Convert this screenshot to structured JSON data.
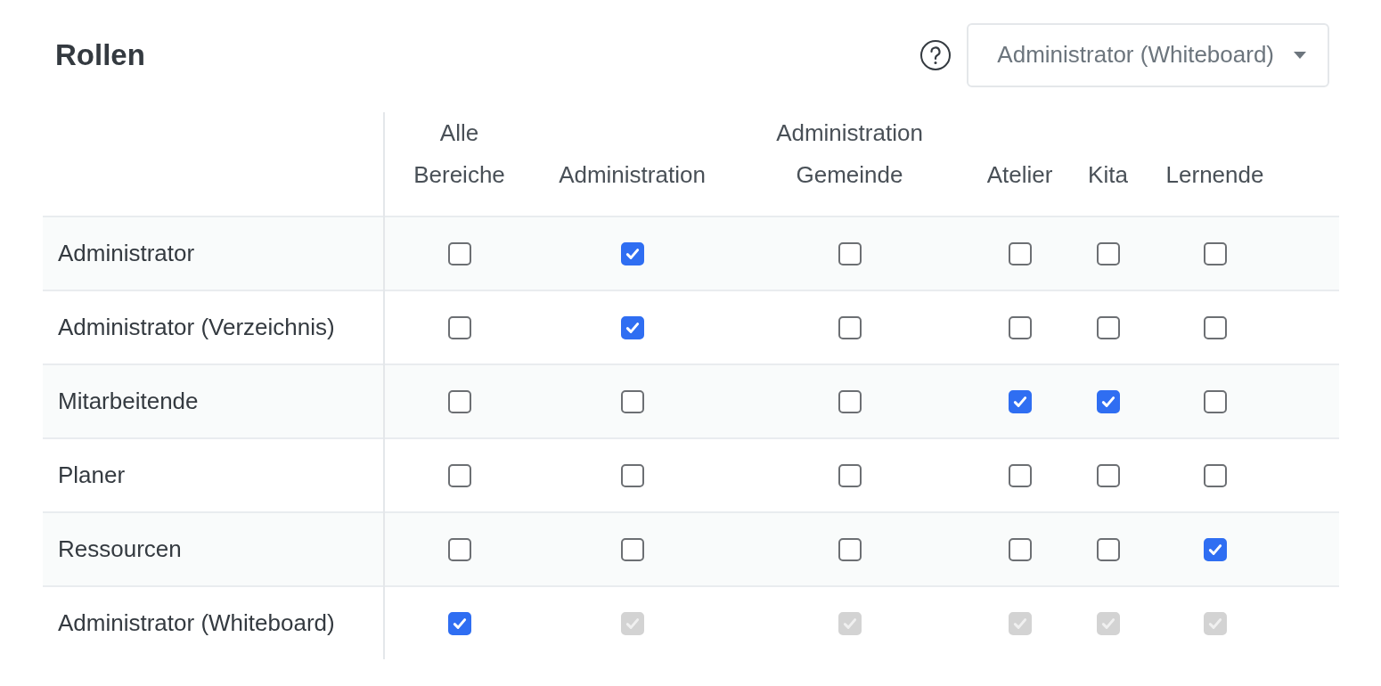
{
  "title": "Rollen",
  "role_select": {
    "value": "Administrator (Whiteboard)"
  },
  "table": {
    "columns": [
      "Alle Bereiche",
      "Administration",
      "Administration Gemeinde",
      "Atelier",
      "Kita",
      "Lernende"
    ],
    "rows": [
      {
        "label": "Administrator",
        "cells": [
          {
            "checked": false,
            "disabled": false
          },
          {
            "checked": true,
            "disabled": false
          },
          {
            "checked": false,
            "disabled": false
          },
          {
            "checked": false,
            "disabled": false
          },
          {
            "checked": false,
            "disabled": false
          },
          {
            "checked": false,
            "disabled": false
          }
        ]
      },
      {
        "label": "Administrator (Verzeichnis)",
        "cells": [
          {
            "checked": false,
            "disabled": false
          },
          {
            "checked": true,
            "disabled": false
          },
          {
            "checked": false,
            "disabled": false
          },
          {
            "checked": false,
            "disabled": false
          },
          {
            "checked": false,
            "disabled": false
          },
          {
            "checked": false,
            "disabled": false
          }
        ]
      },
      {
        "label": "Mitarbeitende",
        "cells": [
          {
            "checked": false,
            "disabled": false
          },
          {
            "checked": false,
            "disabled": false
          },
          {
            "checked": false,
            "disabled": false
          },
          {
            "checked": true,
            "disabled": false
          },
          {
            "checked": true,
            "disabled": false
          },
          {
            "checked": false,
            "disabled": false
          }
        ]
      },
      {
        "label": "Planer",
        "cells": [
          {
            "checked": false,
            "disabled": false
          },
          {
            "checked": false,
            "disabled": false
          },
          {
            "checked": false,
            "disabled": false
          },
          {
            "checked": false,
            "disabled": false
          },
          {
            "checked": false,
            "disabled": false
          },
          {
            "checked": false,
            "disabled": false
          }
        ]
      },
      {
        "label": "Ressourcen",
        "cells": [
          {
            "checked": false,
            "disabled": false
          },
          {
            "checked": false,
            "disabled": false
          },
          {
            "checked": false,
            "disabled": false
          },
          {
            "checked": false,
            "disabled": false
          },
          {
            "checked": false,
            "disabled": false
          },
          {
            "checked": true,
            "disabled": false
          }
        ]
      },
      {
        "label": "Administrator (Whiteboard)",
        "cells": [
          {
            "checked": true,
            "disabled": false
          },
          {
            "checked": true,
            "disabled": true
          },
          {
            "checked": true,
            "disabled": true
          },
          {
            "checked": true,
            "disabled": true
          },
          {
            "checked": true,
            "disabled": true
          },
          {
            "checked": true,
            "disabled": true
          }
        ]
      }
    ]
  }
}
